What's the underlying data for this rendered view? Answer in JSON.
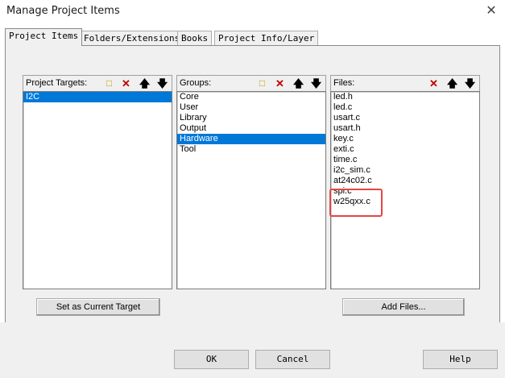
{
  "window": {
    "title": "Manage Project Items",
    "close_glyph": "✕"
  },
  "tabs": [
    {
      "label": "Project Items"
    },
    {
      "label": "Folders/Extensions"
    },
    {
      "label": "Books"
    },
    {
      "label": "Project Info/Layer"
    }
  ],
  "targets": {
    "label": "Project Targets:",
    "items": [
      "I2C"
    ],
    "selected_index": 0,
    "toolbar_icons": [
      "new-icon",
      "delete-icon",
      "move-up-icon",
      "move-down-icon"
    ]
  },
  "groups": {
    "label": "Groups:",
    "items": [
      "Core",
      "User",
      "Library",
      "Output",
      "Hardware",
      "Tool"
    ],
    "selected_index": 4,
    "toolbar_icons": [
      "new-icon",
      "delete-icon",
      "move-up-icon",
      "move-down-icon"
    ]
  },
  "files": {
    "label": "Files:",
    "items": [
      "led.h",
      "led.c",
      "usart.c",
      "usart.h",
      "key.c",
      "exti.c",
      "time.c",
      "i2c_sim.c",
      "at24c02.c",
      "spi.c",
      "w25qxx.c"
    ],
    "toolbar_icons": [
      "delete-icon",
      "move-up-icon",
      "move-down-icon"
    ],
    "highlight_color": "#e64545"
  },
  "buttons": {
    "set_target": "Set as Current Target",
    "add_files": "Add Files...",
    "ok": "OK",
    "cancel": "Cancel",
    "help": "Help"
  },
  "colors": {
    "selection": "#0078d7",
    "dialog_bg": "#f0f0f0"
  }
}
